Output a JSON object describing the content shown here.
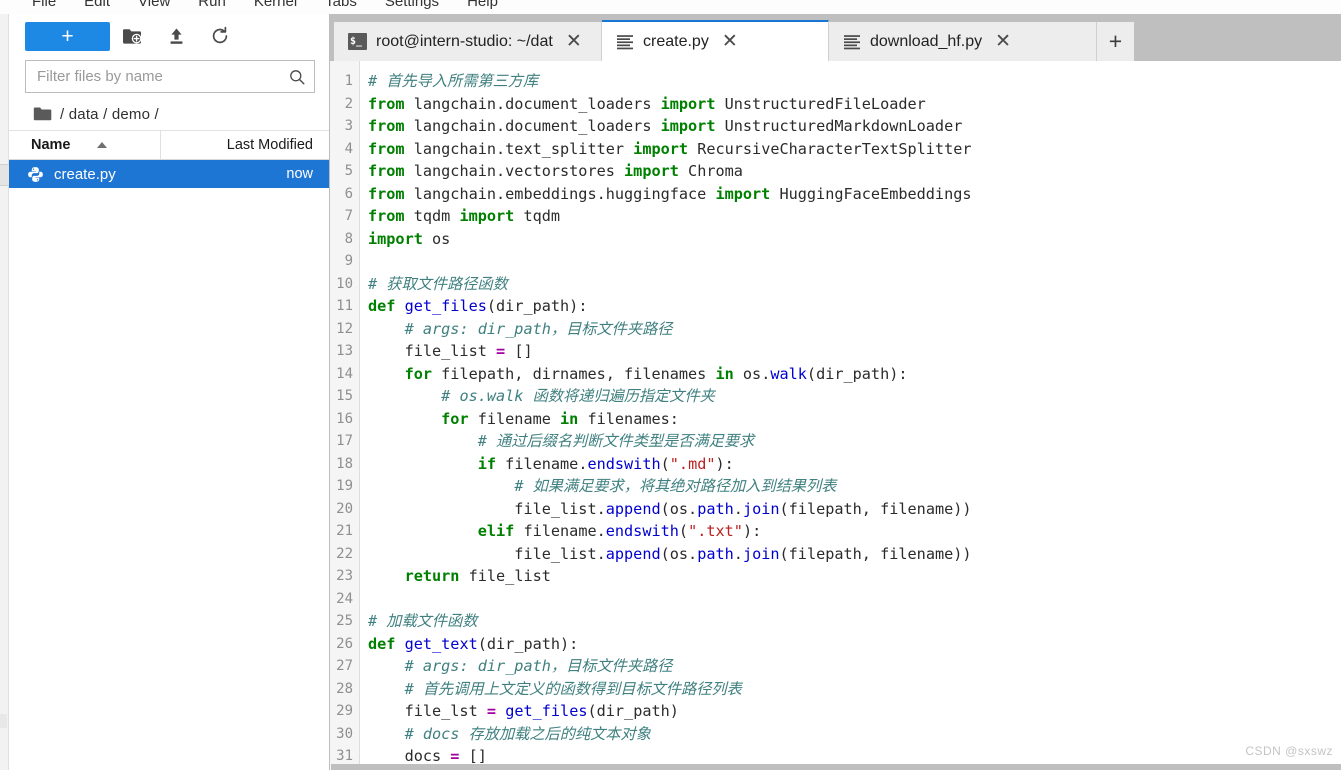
{
  "menubar": {
    "items": [
      "File",
      "Edit",
      "View",
      "Run",
      "Kernel",
      "Tabs",
      "Settings",
      "Help"
    ]
  },
  "filebrowser": {
    "toolbar": {
      "new_launcher_label": "+",
      "new_folder_icon": "new-folder-icon",
      "upload_icon": "upload-icon",
      "refresh_icon": "refresh-icon"
    },
    "filter": {
      "placeholder": "Filter files by name",
      "value": "",
      "icon": "search-icon"
    },
    "breadcrumb": {
      "home_icon": "folder-icon",
      "path": "/ data / demo /"
    },
    "columns": {
      "name": "Name",
      "last_modified": "Last Modified",
      "sort_icon": "sort-asc-caret-icon"
    },
    "files": [
      {
        "name": "create.py",
        "modified": "now",
        "icon": "python-file-icon",
        "selected": true
      }
    ]
  },
  "tabs": [
    {
      "label": "root@intern-studio: ~/dat",
      "icon": "terminal-icon",
      "active": false,
      "closable": true
    },
    {
      "label": "create.py",
      "icon": "text-file-icon",
      "active": true,
      "closable": true
    },
    {
      "label": "download_hf.py",
      "icon": "text-file-icon",
      "active": false,
      "closable": true
    }
  ],
  "tab_add_label": "+",
  "tab_close_label": "✕",
  "editor": {
    "filename": "create.py",
    "first_line_number": 1,
    "lines": [
      {
        "n": 1,
        "tokens": [
          [
            "com",
            "# 首先导入所需第三方库"
          ]
        ]
      },
      {
        "n": 2,
        "tokens": [
          [
            "kw",
            "from"
          ],
          [
            "",
            " langchain.document_loaders "
          ],
          [
            "kw",
            "import"
          ],
          [
            "",
            " UnstructuredFileLoader"
          ]
        ]
      },
      {
        "n": 3,
        "tokens": [
          [
            "kw",
            "from"
          ],
          [
            "",
            " langchain.document_loaders "
          ],
          [
            "kw",
            "import"
          ],
          [
            "",
            " UnstructuredMarkdownLoader"
          ]
        ]
      },
      {
        "n": 4,
        "tokens": [
          [
            "kw",
            "from"
          ],
          [
            "",
            " langchain.text_splitter "
          ],
          [
            "kw",
            "import"
          ],
          [
            "",
            " RecursiveCharacterTextSplitter"
          ]
        ]
      },
      {
        "n": 5,
        "tokens": [
          [
            "kw",
            "from"
          ],
          [
            "",
            " langchain.vectorstores "
          ],
          [
            "kw",
            "import"
          ],
          [
            "",
            " Chroma"
          ]
        ]
      },
      {
        "n": 6,
        "tokens": [
          [
            "kw",
            "from"
          ],
          [
            "",
            " langchain.embeddings.huggingface "
          ],
          [
            "kw",
            "import"
          ],
          [
            "",
            " HuggingFaceEmbeddings"
          ]
        ]
      },
      {
        "n": 7,
        "tokens": [
          [
            "kw",
            "from"
          ],
          [
            "",
            " tqdm "
          ],
          [
            "kw",
            "import"
          ],
          [
            "",
            " tqdm"
          ]
        ]
      },
      {
        "n": 8,
        "tokens": [
          [
            "kw",
            "import"
          ],
          [
            "",
            " os"
          ]
        ]
      },
      {
        "n": 9,
        "tokens": [
          [
            "",
            ""
          ]
        ]
      },
      {
        "n": 10,
        "tokens": [
          [
            "com",
            "# 获取文件路径函数"
          ]
        ]
      },
      {
        "n": 11,
        "tokens": [
          [
            "kw",
            "def"
          ],
          [
            "",
            " "
          ],
          [
            "fn",
            "get_files"
          ],
          [
            "",
            "(dir_path):"
          ]
        ]
      },
      {
        "n": 12,
        "tokens": [
          [
            "",
            "    "
          ],
          [
            "com",
            "# args: dir_path，目标文件夹路径"
          ]
        ]
      },
      {
        "n": 13,
        "tokens": [
          [
            "",
            "    file_list "
          ],
          [
            "op",
            "="
          ],
          [
            "",
            " []"
          ]
        ]
      },
      {
        "n": 14,
        "tokens": [
          [
            "",
            "    "
          ],
          [
            "kw",
            "for"
          ],
          [
            "",
            " filepath, dirnames, filenames "
          ],
          [
            "kw",
            "in"
          ],
          [
            "",
            " os."
          ],
          [
            "fn",
            "walk"
          ],
          [
            "",
            "(dir_path):"
          ]
        ]
      },
      {
        "n": 15,
        "tokens": [
          [
            "",
            "        "
          ],
          [
            "com",
            "# os.walk 函数将递归遍历指定文件夹"
          ]
        ]
      },
      {
        "n": 16,
        "tokens": [
          [
            "",
            "        "
          ],
          [
            "kw",
            "for"
          ],
          [
            "",
            " filename "
          ],
          [
            "kw",
            "in"
          ],
          [
            "",
            " filenames:"
          ]
        ]
      },
      {
        "n": 17,
        "tokens": [
          [
            "",
            "            "
          ],
          [
            "com",
            "# 通过后缀名判断文件类型是否满足要求"
          ]
        ]
      },
      {
        "n": 18,
        "tokens": [
          [
            "",
            "            "
          ],
          [
            "kw",
            "if"
          ],
          [
            "",
            " filename."
          ],
          [
            "fn",
            "endswith"
          ],
          [
            "",
            "("
          ],
          [
            "str",
            "\".md\""
          ],
          [
            "",
            "):"
          ]
        ]
      },
      {
        "n": 19,
        "tokens": [
          [
            "",
            "                "
          ],
          [
            "com",
            "# 如果满足要求，将其绝对路径加入到结果列表"
          ]
        ]
      },
      {
        "n": 20,
        "tokens": [
          [
            "",
            "                file_list."
          ],
          [
            "fn",
            "append"
          ],
          [
            "",
            "(os."
          ],
          [
            "fn",
            "path"
          ],
          [
            "",
            "."
          ],
          [
            "fn",
            "join"
          ],
          [
            "",
            "(filepath, filename))"
          ]
        ]
      },
      {
        "n": 21,
        "tokens": [
          [
            "",
            "            "
          ],
          [
            "kw",
            "elif"
          ],
          [
            "",
            " filename."
          ],
          [
            "fn",
            "endswith"
          ],
          [
            "",
            "("
          ],
          [
            "str",
            "\".txt\""
          ],
          [
            "",
            "):"
          ]
        ]
      },
      {
        "n": 22,
        "tokens": [
          [
            "",
            "                file_list."
          ],
          [
            "fn",
            "append"
          ],
          [
            "",
            "(os."
          ],
          [
            "fn",
            "path"
          ],
          [
            "",
            "."
          ],
          [
            "fn",
            "join"
          ],
          [
            "",
            "(filepath, filename))"
          ]
        ]
      },
      {
        "n": 23,
        "tokens": [
          [
            "",
            "    "
          ],
          [
            "kw",
            "return"
          ],
          [
            "",
            " file_list"
          ]
        ]
      },
      {
        "n": 24,
        "tokens": [
          [
            "",
            ""
          ]
        ]
      },
      {
        "n": 25,
        "tokens": [
          [
            "com",
            "# 加载文件函数"
          ]
        ]
      },
      {
        "n": 26,
        "tokens": [
          [
            "kw",
            "def"
          ],
          [
            "",
            " "
          ],
          [
            "fn",
            "get_text"
          ],
          [
            "",
            "(dir_path):"
          ]
        ]
      },
      {
        "n": 27,
        "tokens": [
          [
            "",
            "    "
          ],
          [
            "com",
            "# args: dir_path，目标文件夹路径"
          ]
        ]
      },
      {
        "n": 28,
        "tokens": [
          [
            "",
            "    "
          ],
          [
            "com",
            "# 首先调用上文定义的函数得到目标文件路径列表"
          ]
        ]
      },
      {
        "n": 29,
        "tokens": [
          [
            "",
            "    file_lst "
          ],
          [
            "op",
            "="
          ],
          [
            "",
            " "
          ],
          [
            "fn",
            "get_files"
          ],
          [
            "",
            "(dir_path)"
          ]
        ]
      },
      {
        "n": 30,
        "tokens": [
          [
            "",
            "    "
          ],
          [
            "com",
            "# docs 存放加载之后的纯文本对象"
          ]
        ]
      },
      {
        "n": 31,
        "tokens": [
          [
            "",
            "    docs "
          ],
          [
            "op",
            "="
          ],
          [
            "",
            " []"
          ]
        ]
      }
    ]
  },
  "watermark": "CSDN @sxswz",
  "colors": {
    "accent_blue": "#1e88e5",
    "selection_blue": "#1e76d4",
    "active_tab_border": "#1976d2",
    "dock_background": "#bfbfbf",
    "keyword_green": "#008000",
    "function_blue": "#0000d0",
    "string_red": "#ba2121",
    "comment_teal": "#408080",
    "operator_purple": "#a000a0"
  }
}
